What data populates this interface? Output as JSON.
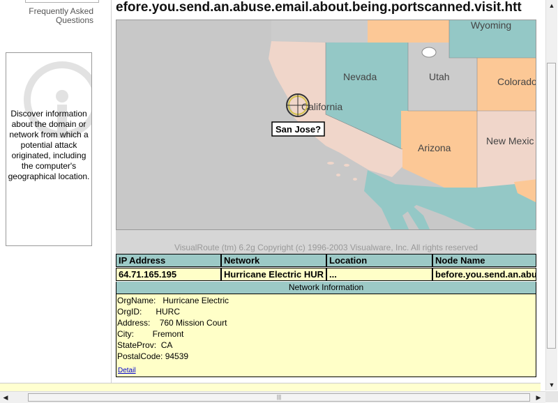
{
  "sidebar": {
    "faq_label": "Frequently Asked Questions",
    "info_text": "Discover information about the domain or network from which a potential attack originated, including the computer's geographical location."
  },
  "main": {
    "node_heading": "efore.you.send.an.abuse.email.about.being.portscanned.visit.htt",
    "map": {
      "states": [
        "Nevada",
        "Utah",
        "Colorado",
        "California",
        "Arizona",
        "New Mexic",
        "Wyoming"
      ],
      "city_label": "San Jose?",
      "colors": {
        "ocean": "#c8c8c8",
        "pink": "#f0d6ca",
        "teal": "#94c8c6",
        "orange": "#fcc896",
        "gray": "#cccccc"
      }
    },
    "copyright": "VisualRoute (tm) 6.2g Copyright (c) 1996-2003 Visualware, Inc. All rights reserved",
    "table": {
      "headers": [
        "IP Address",
        "Network",
        "Location",
        "Node Name"
      ],
      "row": [
        "64.71.165.195",
        "Hurricane Electric HUR",
        "...",
        "before.you.send.an.abus"
      ]
    },
    "network_info": {
      "title": "Network Information",
      "lines": [
        "OrgName:   Hurricane Electric",
        "OrgID:      HURC",
        "Address:    760 Mission Court",
        "City:        Fremont",
        "StateProv:  CA",
        "PostalCode: 94539"
      ],
      "detail_link": "Detail"
    }
  },
  "scrollbar": {
    "grip": "|||"
  }
}
